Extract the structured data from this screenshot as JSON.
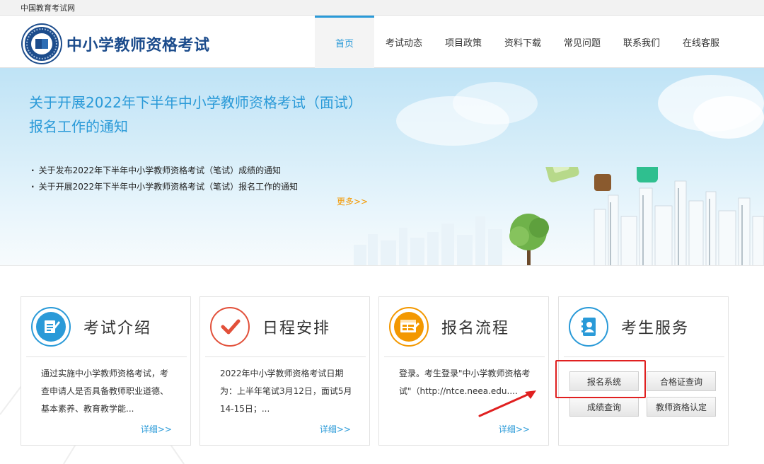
{
  "topbar": {
    "site_link": "中国教育考试网"
  },
  "header": {
    "logo_text": "中小学教师资格考试",
    "nav": [
      {
        "label": "首页",
        "active": true
      },
      {
        "label": "考试动态",
        "active": false
      },
      {
        "label": "项目政策",
        "active": false
      },
      {
        "label": "资料下载",
        "active": false
      },
      {
        "label": "常见问题",
        "active": false
      },
      {
        "label": "联系我们",
        "active": false
      },
      {
        "label": "在线客服",
        "active": false
      }
    ]
  },
  "banner": {
    "headline": "关于开展2022年下半年中小学教师资格考试（面试）报名工作的通知",
    "news": [
      "关于发布2022年下半年中小学教师资格考试（笔试）成绩的通知",
      "关于开展2022年下半年中小学教师资格考试（笔试）报名工作的通知"
    ],
    "more": "更多>>"
  },
  "cards": [
    {
      "title": "考试介绍",
      "text": "通过实施中小学教师资格考试，考查申请人是否具备教师职业道德、基本素养、教育教学能...",
      "more": "详细>>",
      "icon": "edit-document-icon",
      "color": "#2a9ad8"
    },
    {
      "title": "日程安排",
      "text": "2022年中小学教师资格考试日期为：上半年笔试3月12日，面试5月14-15日；...",
      "more": "详细>>",
      "icon": "checkmark-icon",
      "color": "#e2503a"
    },
    {
      "title": "报名流程",
      "text": "登录。考生登录\"中小学教师资格考试\"（http://ntce.neea.edu....",
      "more": "详细>>",
      "icon": "registration-form-icon",
      "color": "#f39800"
    },
    {
      "title": "考生服务",
      "icon": "address-book-icon",
      "color": "#2a9ad8"
    }
  ],
  "services": {
    "registration": "报名系统",
    "certificate_query": "合格证查询",
    "score_query": "成绩查询",
    "qualification": "教师资格认定"
  },
  "colors": {
    "brand_blue": "#1c4c8c",
    "accent_blue": "#2a9ad8",
    "more_orange": "#f39800",
    "highlight_red": "#e02020"
  }
}
